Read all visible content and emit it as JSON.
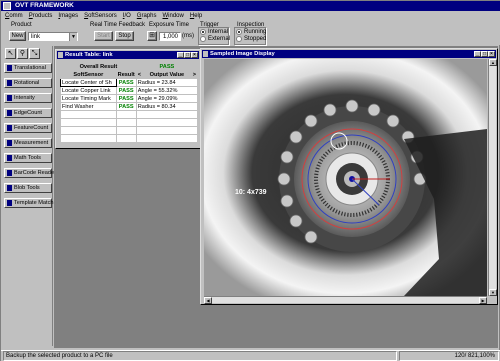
{
  "app": {
    "title": "OVT FRAMEWORK"
  },
  "menu": [
    {
      "pre": "",
      "u": "C",
      "post": "omm"
    },
    {
      "pre": "",
      "u": "P",
      "post": "roducts"
    },
    {
      "pre": "",
      "u": "I",
      "post": "mages"
    },
    {
      "pre": "",
      "u": "S",
      "post": "oftSensors"
    },
    {
      "pre": "",
      "u": "I",
      "post": "/O"
    },
    {
      "pre": "",
      "u": "G",
      "post": "raphs"
    },
    {
      "pre": "",
      "u": "W",
      "post": "indow"
    },
    {
      "pre": "",
      "u": "H",
      "post": "elp"
    }
  ],
  "toolbar": {
    "product_label": "Product",
    "new_label": "New",
    "product_value": "link",
    "realtime_label": "Real Time Feedback",
    "start_label": "Start",
    "stop_label": "Stop",
    "exposure_label": "Exposure Time",
    "exposure_value": "1,000",
    "exposure_unit": "(ms)",
    "trigger_label": "Trigger",
    "trigger_internal": "Internal",
    "trigger_external": "External",
    "inspection_label": "Inspection",
    "inspection_running": "Running",
    "inspection_stopped": "Stopped"
  },
  "softsensors": [
    "Translational",
    "Rotational",
    "Intensity",
    "EdgeCount",
    "FeatureCount",
    "Measurement",
    "Math Tools",
    "BarCode Reader",
    "Blob Tools",
    "Template Match"
  ],
  "result_table": {
    "title": "Result Table: link",
    "overall_label": "Overall Result",
    "overall_value": "PASS",
    "col_softsensor": "SoftSensor",
    "col_result": "Result",
    "col_nav": "<",
    "col_output": "Output Value",
    "col_nav2": ">",
    "rows": [
      {
        "name": "Locate Center of Sh",
        "result": "PASS",
        "output": "Radius = 23.84"
      },
      {
        "name": "Locate Copper Link",
        "result": "PASS",
        "output": "Angle = 55.32%"
      },
      {
        "name": "Locate Timing Mark",
        "result": "PASS",
        "output": "Angle = 29.09%"
      },
      {
        "name": "Find Washer",
        "result": "PASS",
        "output": "Radius = 80.34"
      }
    ]
  },
  "image_window": {
    "title": "Sampled Image Display",
    "coord_text": "10: 4x739"
  },
  "status": {
    "message": "Backup the selected product to a PC file",
    "right": "120/ 821,100%"
  },
  "colors": {
    "titlebar": "#000080",
    "pass": "#008000",
    "face": "#c0c0c0"
  }
}
